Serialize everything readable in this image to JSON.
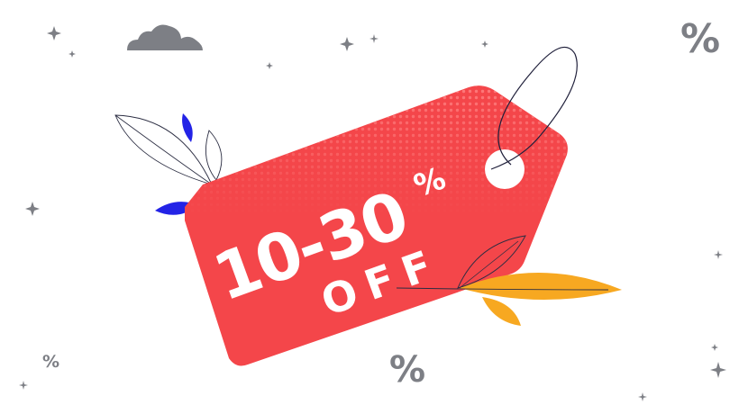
{
  "banner": {
    "range_label": "10-30",
    "percent_sign": "%",
    "off_label": "OFF"
  },
  "decor": {
    "percent_marks": [
      "%",
      "%",
      "%"
    ],
    "icons": [
      "cloud-icon",
      "sparkle-icon",
      "leaf-icon",
      "percent-icon"
    ]
  },
  "colors": {
    "tag": "#f4464a",
    "tag_halftone": "#ff7a7a",
    "text": "#ffffff",
    "leaf_blue": "#2323e6",
    "leaf_orange": "#f7a821",
    "decor_gray": "#7d7f85"
  }
}
